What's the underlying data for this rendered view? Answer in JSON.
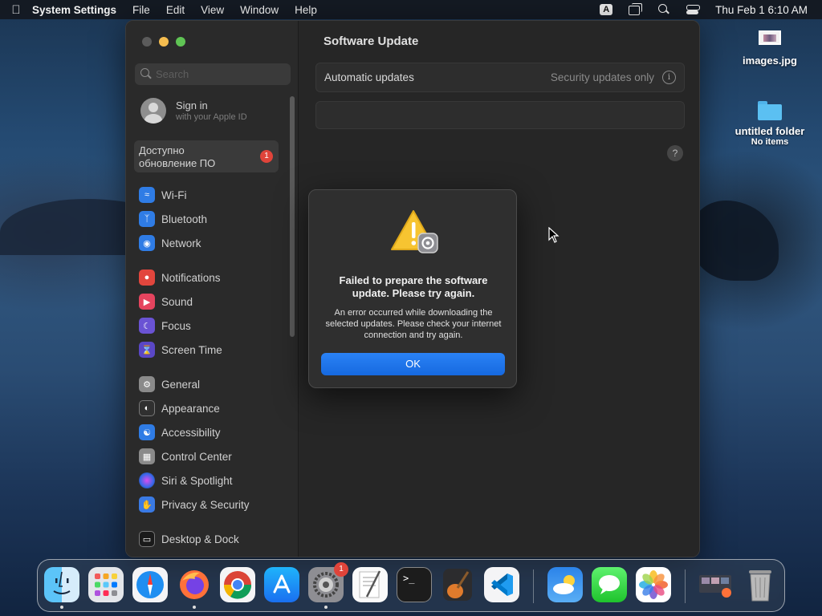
{
  "menubar": {
    "app_name": "System Settings",
    "menus": [
      "File",
      "Edit",
      "View",
      "Window",
      "Help"
    ],
    "input_source": "A",
    "datetime": "Thu Feb 1  6:10 AM"
  },
  "sidebar": {
    "search_placeholder": "Search",
    "signin_title": "Sign in",
    "signin_subtitle": "with your Apple ID",
    "update_label_line1": "Доступно",
    "update_label_line2": "обновление ПО",
    "update_badge": "1",
    "groups": [
      [
        {
          "label": "Wi-Fi",
          "icon": "wifi-icon",
          "color": "blue"
        },
        {
          "label": "Bluetooth",
          "icon": "bluetooth-icon",
          "color": "blue"
        },
        {
          "label": "Network",
          "icon": "network-globe-icon",
          "color": "blue"
        }
      ],
      [
        {
          "label": "Notifications",
          "icon": "bell-icon",
          "color": "red"
        },
        {
          "label": "Sound",
          "icon": "speaker-icon",
          "color": "pink"
        },
        {
          "label": "Focus",
          "icon": "moon-icon",
          "color": "purple"
        },
        {
          "label": "Screen Time",
          "icon": "hourglass-icon",
          "color": "indigo"
        }
      ],
      [
        {
          "label": "General",
          "icon": "gear-icon",
          "color": "gray"
        },
        {
          "label": "Appearance",
          "icon": "appearance-icon",
          "color": "dark"
        },
        {
          "label": "Accessibility",
          "icon": "accessibility-icon",
          "color": "blue"
        },
        {
          "label": "Control Center",
          "icon": "control-center-icon",
          "color": "gray"
        },
        {
          "label": "Siri & Spotlight",
          "icon": "siri-icon",
          "color": "siri"
        },
        {
          "label": "Privacy & Security",
          "icon": "hand-icon",
          "color": "hand"
        }
      ],
      [
        {
          "label": "Desktop & Dock",
          "icon": "dock-icon",
          "color": "dock"
        }
      ]
    ]
  },
  "main": {
    "title": "Software Update",
    "auto_updates_label": "Automatic updates",
    "auto_updates_value": "Security updates only",
    "help_label": "?"
  },
  "dialog": {
    "title": "Failed to prepare the software update. Please try again.",
    "message": "An error occurred while downloading the selected updates. Please check your internet connection and try again.",
    "ok_label": "OK"
  },
  "desktop": {
    "items": [
      {
        "label": "images.jpg",
        "sub": "",
        "kind": "image"
      },
      {
        "label": "untitled folder",
        "sub": "No items",
        "kind": "folder"
      }
    ]
  },
  "dock": {
    "apps": [
      {
        "name": "finder-icon",
        "running": true
      },
      {
        "name": "launchpad-icon",
        "running": false
      },
      {
        "name": "safari-icon",
        "running": false
      },
      {
        "name": "firefox-icon",
        "running": true
      },
      {
        "name": "chrome-icon",
        "running": false
      },
      {
        "name": "app-store-icon",
        "running": false
      },
      {
        "name": "system-settings-icon",
        "running": true,
        "badge": "1"
      },
      {
        "name": "textedit-icon",
        "running": false
      },
      {
        "name": "terminal-icon",
        "running": false
      },
      {
        "name": "garageband-icon",
        "running": false
      },
      {
        "name": "vscode-icon",
        "running": false
      },
      {
        "name": "weather-icon",
        "running": false
      },
      {
        "name": "messages-icon",
        "running": false
      },
      {
        "name": "photos-icon",
        "running": false
      },
      {
        "name": "downloads-stack-icon",
        "running": false
      },
      {
        "name": "trash-icon",
        "running": false
      }
    ]
  }
}
